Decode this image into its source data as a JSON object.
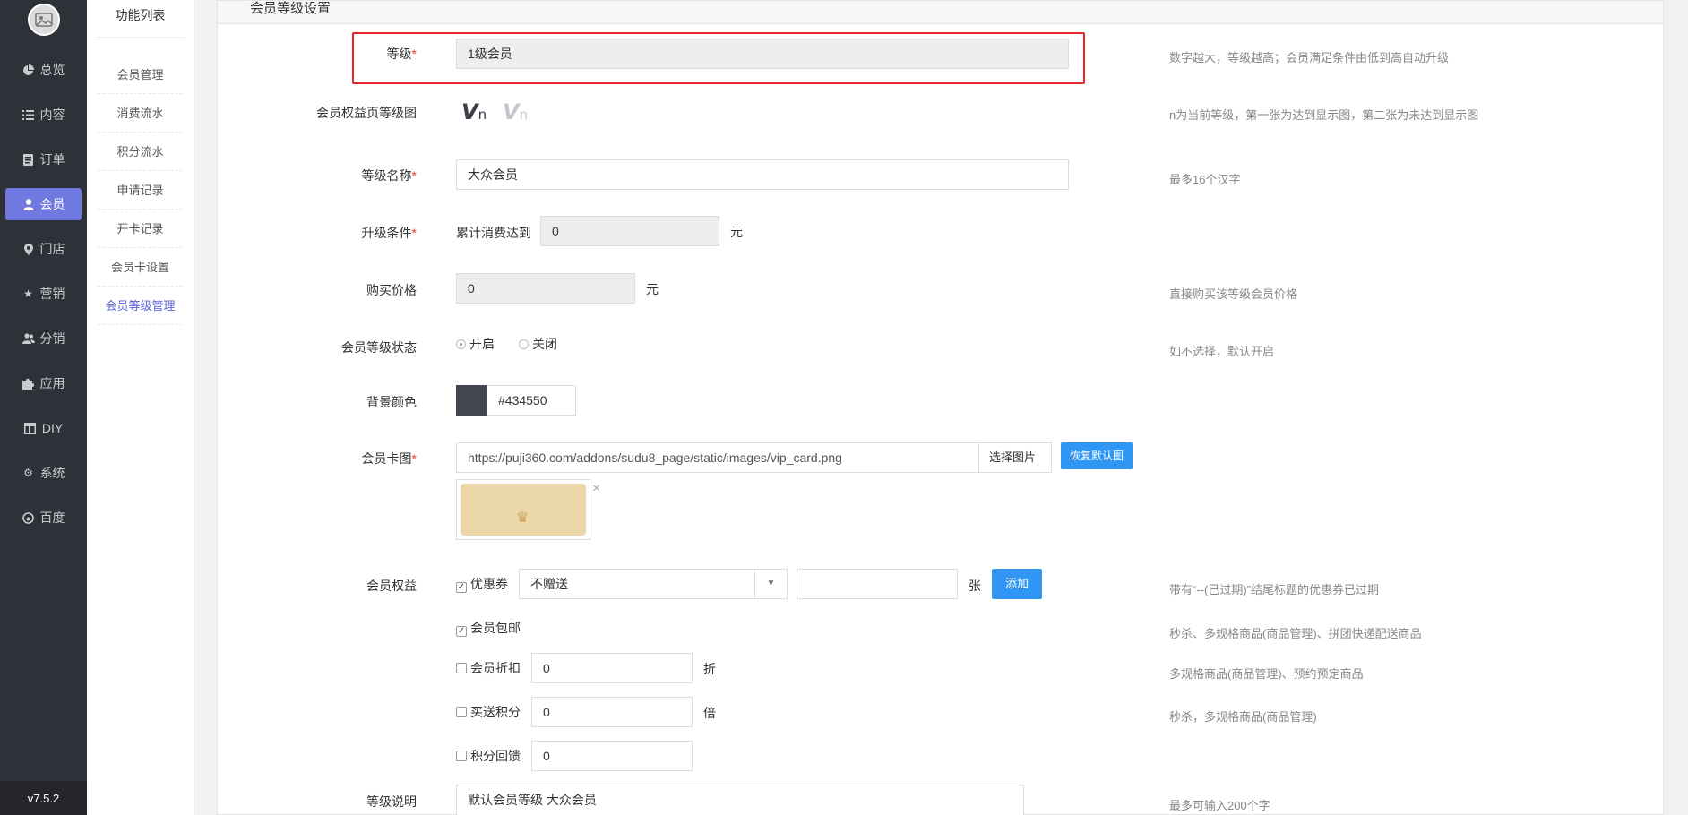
{
  "sidebar": {
    "items": [
      {
        "label": "总览",
        "icon": "pie-chart-icon"
      },
      {
        "label": "内容",
        "icon": "list-icon"
      },
      {
        "label": "订单",
        "icon": "order-icon"
      },
      {
        "label": "会员",
        "icon": "user-icon",
        "active": true
      },
      {
        "label": "门店",
        "icon": "map-pin-icon"
      },
      {
        "label": "营销",
        "icon": "star-icon"
      },
      {
        "label": "分销",
        "icon": "users-icon"
      },
      {
        "label": "应用",
        "icon": "puzzle-icon"
      },
      {
        "label": "DIY",
        "icon": "layout-icon"
      },
      {
        "label": "系统",
        "icon": "gear-icon"
      },
      {
        "label": "百度",
        "icon": "baidu-icon"
      }
    ],
    "version": "v7.5.2"
  },
  "subnav": {
    "title": "功能列表",
    "items": [
      "会员管理",
      "消费流水",
      "积分流水",
      "申请记录",
      "开卡记录",
      "会员卡设置",
      "会员等级管理"
    ]
  },
  "panel": {
    "title": "会员等级设置"
  },
  "form": {
    "level": {
      "label": "等级",
      "value": "1级会员",
      "hint": "数字越大，等级越高；会员满足条件由低到高自动升级"
    },
    "benefit_img": {
      "label": "会员权益页等级图",
      "vn": "V",
      "sub": "n",
      "hint": "n为当前等级，第一张为达到显示图，第二张为未达到显示图"
    },
    "name": {
      "label": "等级名称",
      "value": "大众会员",
      "hint": "最多16个汉字"
    },
    "upgrade": {
      "label": "升级条件",
      "prefix": "累计消费达到",
      "value": "0",
      "unit": "元"
    },
    "price": {
      "label": "购买价格",
      "value": "0",
      "unit": "元",
      "hint": "直接购买该等级会员价格"
    },
    "status": {
      "label": "会员等级状态",
      "on": "开启",
      "off": "关闭",
      "hint": "如不选择，默认开启"
    },
    "bg_color": {
      "label": "背景颜色",
      "value": "#434550",
      "color": "#434550"
    },
    "card_img": {
      "label": "会员卡图",
      "value": "https://puji360.com/addons/sudu8_page/static/images/vip_card.png",
      "choose": "选择图片",
      "restore": "恢复默认图"
    },
    "rights": {
      "label": "会员权益",
      "coupon": {
        "label": "优惠券",
        "checked": true,
        "select": "不赠送",
        "unit": "张",
        "add": "添加",
        "hint": "带有“--(已过期)”结尾标题的优惠券已过期"
      },
      "free_ship": {
        "label": "会员包邮",
        "checked": true,
        "hint": "秒杀、多规格商品(商品管理)、拼团快递配送商品"
      },
      "discount": {
        "label": "会员折扣",
        "checked": false,
        "value": "0",
        "unit": "折",
        "hint": "多规格商品(商品管理)、预约预定商品"
      },
      "points": {
        "label": "买送积分",
        "checked": false,
        "value": "0",
        "unit": "倍",
        "hint": "秒杀，多规格商品(商品管理)"
      },
      "cashback": {
        "label": "积分回馈",
        "checked": false,
        "value": "0"
      }
    },
    "desc": {
      "label": "等级说明",
      "value": "默认会员等级 大众会员",
      "hint": "最多可输入200个字"
    }
  },
  "colors": {
    "accent": "#6f79e0",
    "sidebar_bg": "#2f3139",
    "highlight": "#e6262b",
    "button": "#2f96f3"
  }
}
